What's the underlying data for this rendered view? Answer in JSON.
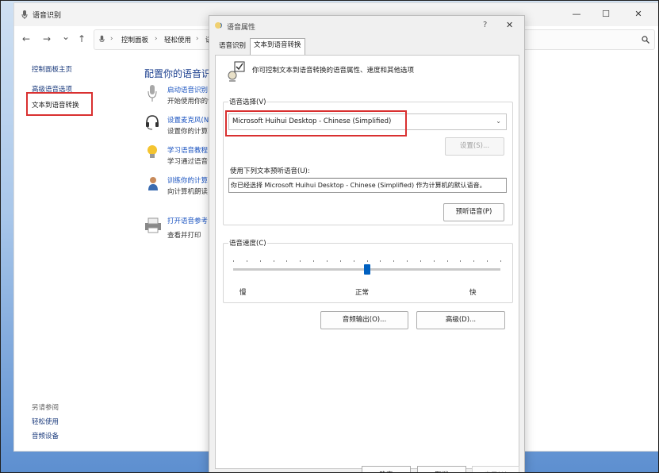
{
  "main_window": {
    "title": "语音识别",
    "breadcrumb": [
      "控制面板",
      "轻松使用",
      "语"
    ],
    "nav_buttons": {
      "back": "←",
      "forward": "→",
      "down": "⌄",
      "up": "↑"
    },
    "window_controls": {
      "minimize": "—",
      "maximize": "☐",
      "close": "✕"
    },
    "sidebar": {
      "items": [
        "控制面板主页",
        "高级语音选项",
        "文本到语音转换"
      ],
      "see_also_title": "另请参阅",
      "see_also": [
        "轻松使用",
        "音频设备"
      ]
    },
    "heading": "配置你的语音识",
    "items": [
      {
        "title": "启动语音识别",
        "sub": "开始使用你的语",
        "icon": "microphone-icon"
      },
      {
        "title": "设置麦克风(N",
        "sub": "设置你的计算",
        "icon": "headset-icon"
      },
      {
        "title": "学习语音教程",
        "sub": "学习通过语音",
        "icon": "lightbulb-icon"
      },
      {
        "title": "训练你的计算",
        "sub": "向计算机朗读",
        "icon": "user-icon"
      },
      {
        "title": "打开语音参考",
        "sub": "查看并打印",
        "icon": "printer-icon"
      }
    ]
  },
  "dialog": {
    "title": "语音属性",
    "help": "?",
    "close": "✕",
    "tabs": [
      "语音识别",
      "文本到语音转换"
    ],
    "active_tab": 1,
    "description": "你可控制文本到语音转换的语音属性、速度和其他选项",
    "voice_group_label": "语音选择(V)",
    "voice_selected": "Microsoft Huihui Desktop - Chinese (Simplified)",
    "settings_button": "设置(S)...",
    "preview_label": "使用下列文本预听语音(U):",
    "preview_text": "你已经选择 Microsoft Huihui Desktop - Chinese (Simplified) 作为计算机的默认语音。",
    "preview_button": "预听语音(P)",
    "speed_group_label": "语音速度(C)",
    "speed_labels": [
      "慢",
      "正常",
      "快"
    ],
    "speed_level": 0.5,
    "audio_output_button": "音频输出(O)...",
    "advanced_button": "高级(D)...",
    "ok_button": "确定",
    "cancel_button": "取消",
    "apply_button": "应用(A)"
  },
  "colors": {
    "highlight": "#d93030",
    "link": "#1a53c0",
    "slider_thumb": "#0060c0"
  }
}
